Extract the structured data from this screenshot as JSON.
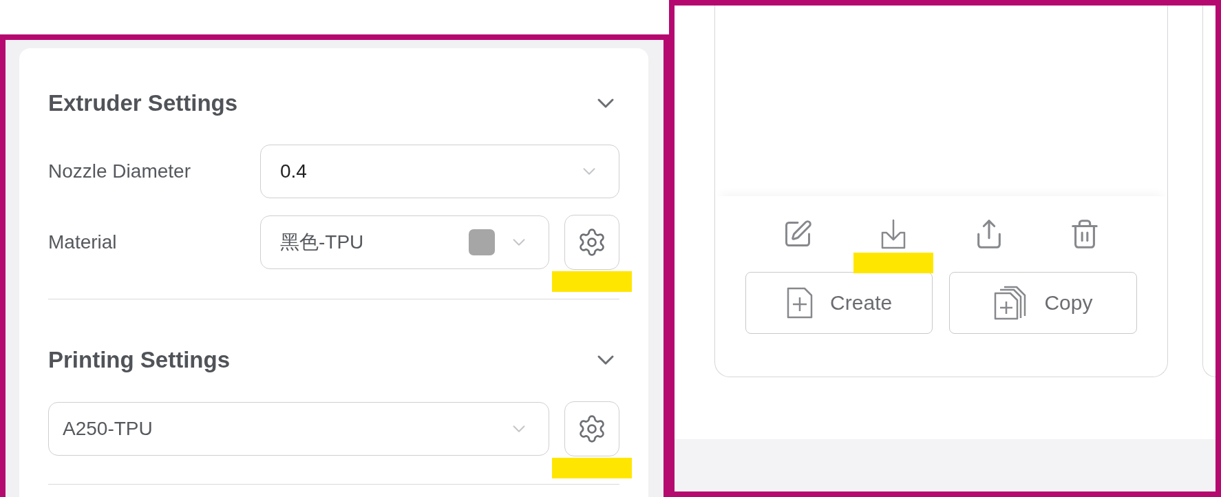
{
  "extruder": {
    "title": "Extruder Settings",
    "expanded": true,
    "nozzle_label": "Nozzle Diameter",
    "nozzle_value": "0.4",
    "material_label": "Material",
    "material_value": "黑色-TPU",
    "gear_highlighted": true
  },
  "printing": {
    "title": "Printing Settings",
    "expanded": true,
    "profile_value": "A250-TPU",
    "gear_highlighted": true
  },
  "toolbar": [
    {
      "kind": "edit",
      "highlighted": false
    },
    {
      "kind": "import",
      "highlighted": true
    },
    {
      "kind": "export",
      "highlighted": false
    },
    {
      "kind": "delete",
      "highlighted": false
    }
  ],
  "buttons": [
    {
      "kind": "create",
      "label": "Create"
    },
    {
      "kind": "copy",
      "label": "Copy"
    }
  ]
}
